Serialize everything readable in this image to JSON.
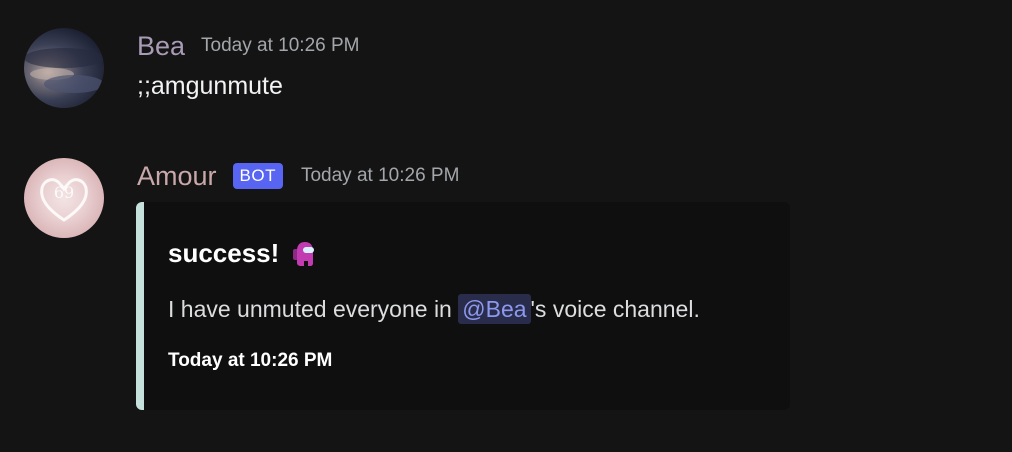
{
  "messages": [
    {
      "username": "Bea",
      "timestamp": "Today at 10:26 PM",
      "content": ";;amgunmute"
    },
    {
      "username": "Amour",
      "badge": "BOT",
      "timestamp": "Today at 10:26 PM",
      "embed": {
        "title": "success!",
        "title_icon": "among-us-crewmate-icon",
        "description_prefix": "I have unmuted everyone in ",
        "mention": "@Bea",
        "description_suffix": "'s voice channel.",
        "footer": "Today at 10:26 PM",
        "accent_color": "#c6e0dc"
      }
    }
  ],
  "colors": {
    "background": "#141414",
    "bot_badge": "#5865f2",
    "mention_text": "#8d99ee",
    "mention_bg": "#292c4a"
  }
}
